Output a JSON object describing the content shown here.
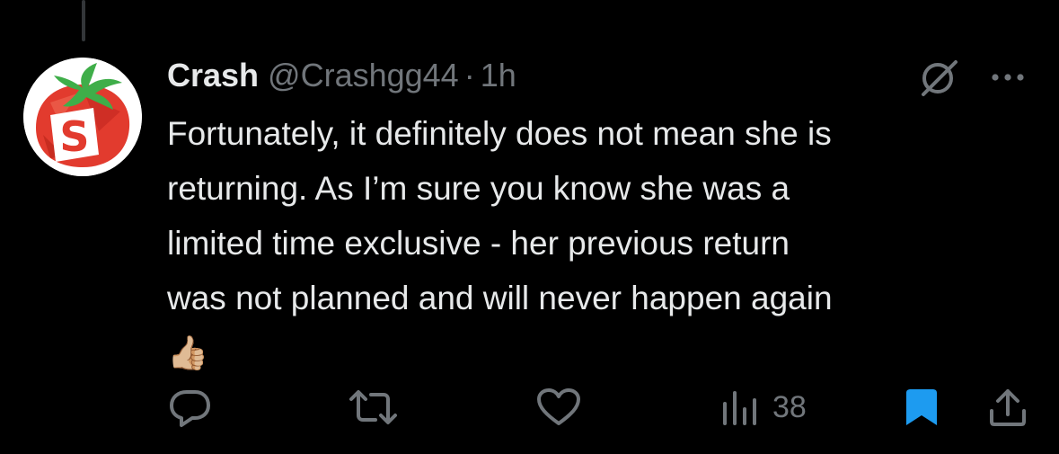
{
  "tweet": {
    "display_name": "Crash",
    "handle": "@Crashgg44",
    "separator": "·",
    "time": "1h",
    "text": "Fortunately, it definitely does not mean she is\nreturning. As I’m sure you know she was a\nlimited time exclusive - her previous return\nwas not planned and will never happen again\n👍🏼",
    "avatar": {
      "letter": "S",
      "fruit_color": "#e23b2e",
      "leaf_color": "#3fae49"
    }
  },
  "top_icons": {
    "blocked": "slash-circle-icon",
    "more": "more-dots-icon"
  },
  "actions": {
    "reply_icon": "reply-icon",
    "repost_icon": "repost-icon",
    "like_icon": "heart-icon",
    "views_icon": "views-bar-chart-icon",
    "views_count": "38",
    "bookmark_icon": "bookmark-icon",
    "bookmark_color": "#1d9bf0",
    "share_icon": "share-icon"
  },
  "colors": {
    "background": "#000000",
    "text": "#e7e9ea",
    "secondary": "#71767b",
    "accent": "#1d9bf0"
  }
}
